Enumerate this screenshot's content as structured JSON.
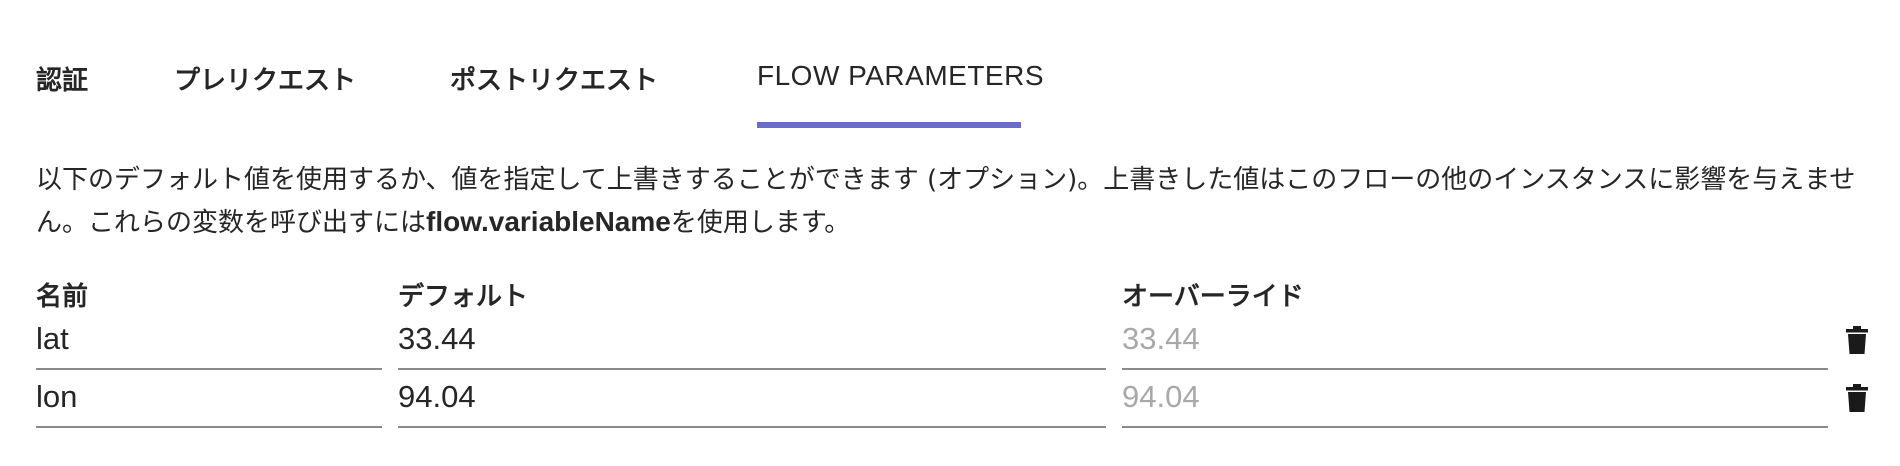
{
  "tabs": [
    {
      "label": "認証"
    },
    {
      "label": "プレリクエスト"
    },
    {
      "label": "ポストリクエスト"
    },
    {
      "label": "FLOW PARAMETERS",
      "active": true
    }
  ],
  "accent_color": "#6b6bc9",
  "description": {
    "text_before": "以下のデフォルト値を使用するか、値を指定して上書きすることができます (オプション)。上書きした値はこのフローの他のインスタンスに影響を与えません。これらの変数を呼び出すには",
    "code": "flow.variableName",
    "text_after": "を使用します。"
  },
  "table": {
    "headers": {
      "name": "名前",
      "default": "デフォルト",
      "override": "オーバーライド"
    },
    "rows": [
      {
        "name": "lat",
        "default": "33.44",
        "override_placeholder": "33.44",
        "override": ""
      },
      {
        "name": "lon",
        "default": "94.04",
        "override_placeholder": "94.04",
        "override": ""
      }
    ],
    "row_action_icon": "trash-icon"
  }
}
